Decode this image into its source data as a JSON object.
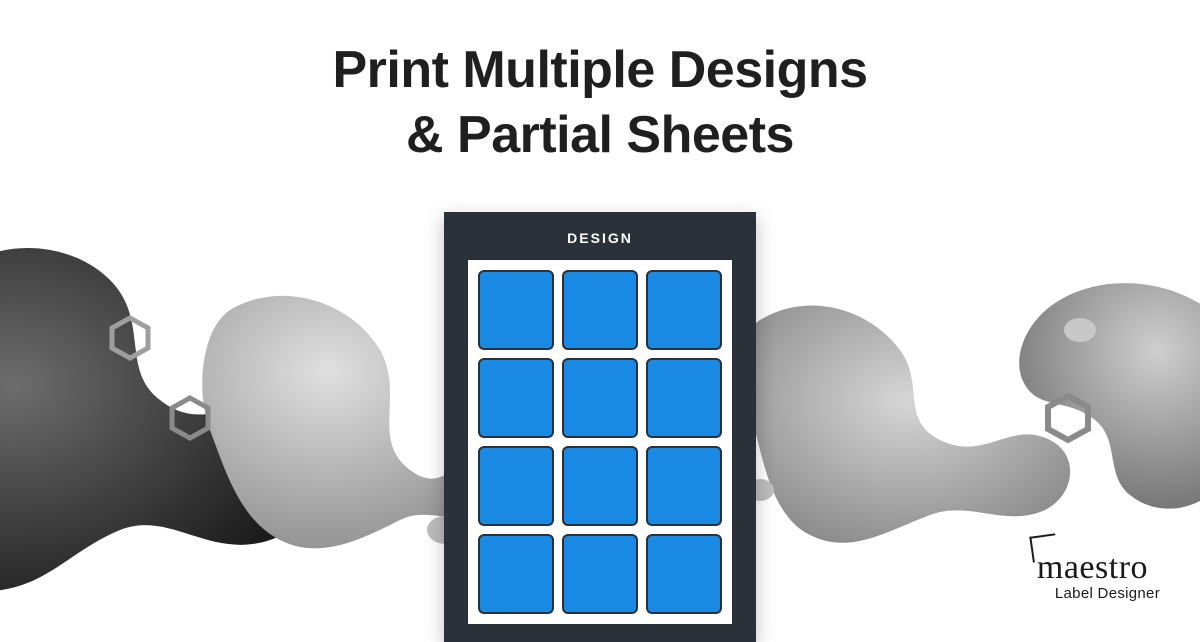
{
  "heading_line1": "Print Multiple Designs",
  "heading_line2": "& Partial Sheets",
  "panel": {
    "title": "DESIGN",
    "grid_cols": 3,
    "grid_rows": 4,
    "cell_color": "#1a89e3"
  },
  "brand": {
    "name": "maestro",
    "tagline": "Label Designer"
  }
}
